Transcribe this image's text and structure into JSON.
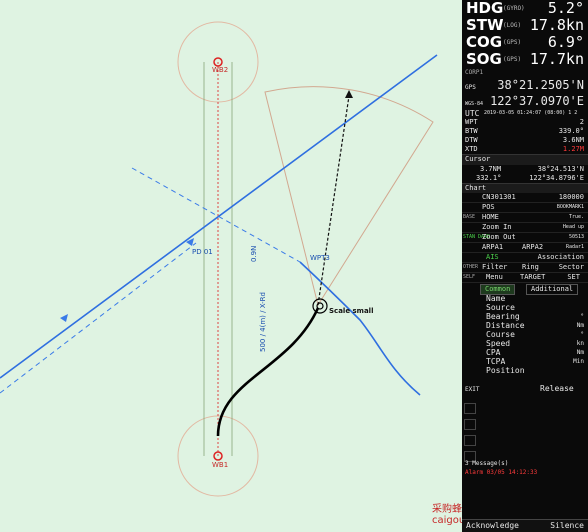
{
  "chart": {
    "wp2_label": "WB2",
    "wp1_label": "WB1",
    "wpt3_label": "WPT3",
    "pd1_label": "PD 01",
    "leg_text_1": "0.9N",
    "leg_text_2": "500 / 4(m) / X-Rd",
    "ship_label": "Scale small",
    "watermark": "采购蜂 caigoufeng.com"
  },
  "nav": [
    {
      "key": "HDG",
      "sub": "(GYRO)",
      "value": "5.2°"
    },
    {
      "key": "STW",
      "sub": "(LOG)",
      "value": "17.8kn"
    },
    {
      "key": "COG",
      "sub": "(GPS)",
      "value": "6.9°"
    },
    {
      "key": "SOG",
      "sub": "(GPS)",
      "value": "17.7kn"
    }
  ],
  "corp_label": "CORP1",
  "gps": {
    "label": "GPS",
    "lat": "38°21.2505'N",
    "lon": "122°37.0970'E",
    "lon_prefix": "WGS-84"
  },
  "utc": {
    "label": "UTC",
    "value": "2019-03-05 01:24:07 (08:00) 1  2"
  },
  "wpt": [
    {
      "k": "WPT",
      "v": "2"
    },
    {
      "k": "BTW",
      "v": "339.0°"
    },
    {
      "k": "DTW",
      "v": "3.6NM"
    },
    {
      "k": "XTD",
      "v": "1.27M",
      "alert": true
    }
  ],
  "cursor": {
    "title": "Cursor",
    "dist": "3.7NM",
    "bearing": "332.1°",
    "lat": "38°24.513'N",
    "lon": "122°34.8796'E"
  },
  "chart_section": {
    "title": "Chart",
    "cn": "CN301301",
    "scale": "180000",
    "pos": "POS",
    "bookmark": "BOOKMARK1",
    "home": "HOME",
    "home_v": "True.",
    "zin": "Zoom In",
    "zin_v": "Head up",
    "zout": "Zoom Out",
    "zout_v": "50513",
    "arpa1": "ARPA1",
    "arpa2": "ARPA2",
    "radar": "Radar1",
    "ais": "AIS",
    "assoc": "Association",
    "filter": "Filter",
    "ring": "Ring",
    "sector": "Sector",
    "menu": "Menu",
    "target": "TARGET",
    "set": "SET"
  },
  "side_tags": {
    "base": "BASE",
    "standard": "STAN DARD",
    "other": "OTHER",
    "self": "SELF"
  },
  "tabs": {
    "common": "Common",
    "additional": "Additional"
  },
  "target_items": [
    {
      "label": "Name",
      "unit": ""
    },
    {
      "label": "Source",
      "unit": ""
    },
    {
      "label": "Bearing",
      "unit": "°"
    },
    {
      "label": "Distance",
      "unit": "Nm"
    },
    {
      "label": "Course",
      "unit": "°"
    },
    {
      "label": "Speed",
      "unit": "kn"
    },
    {
      "label": "CPA",
      "unit": "Nm"
    },
    {
      "label": "TCPA",
      "unit": "Min"
    },
    {
      "label": "Position",
      "unit": ""
    }
  ],
  "exit": "EXIT",
  "release": "Release",
  "messages": "3 Message(s)",
  "alarm_line": "Alarm  03/05 14:12:33",
  "acknowledge": "Acknowledge",
  "silence": "Silence"
}
